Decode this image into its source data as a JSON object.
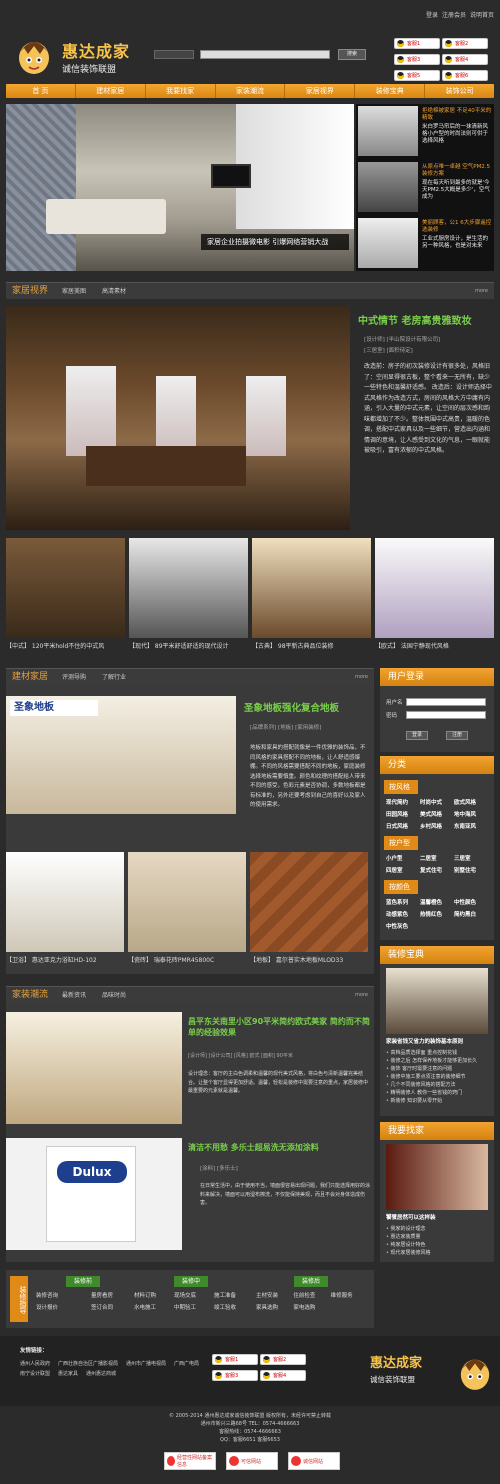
{
  "top_links": [
    "登录",
    "注册会员",
    "说明首页"
  ],
  "logo": {
    "title": "惠达成家",
    "subtitle": "诚信装饰联盟"
  },
  "search": {
    "select": "",
    "button": "搜索"
  },
  "qq": [
    "客服1",
    "客服2",
    "客服3",
    "客服4",
    "客服5",
    "客服6"
  ],
  "nav": [
    "首 页",
    "建材家居",
    "我要找家",
    "家装潮流",
    "家居视界",
    "装修宝典",
    "装饰公司"
  ],
  "hero": {
    "caption": "家居企业拍摄微电影 引爆网络营销大战"
  },
  "hero_side": [
    {
      "title": "拒绝棉被家居\n不足40平米的精致",
      "text": ""
    },
    {
      "title": "改造前：",
      "text": "米白罗马帘后的一抹清新风格小户型的时尚法则可供于选择风格"
    },
    {
      "title": "从原点唯一卓越\n空气PM2.5装修方案",
      "text": "现在每天听到最多的就是'今天PM2.5大概是多少'，空气成为"
    },
    {
      "title": "美丽顾客，公1\n6大步骤遥控选装修",
      "text": "工业式厨房设计，是生活的另一种风格，也是对未来"
    }
  ],
  "sec1": {
    "title": "家居视界",
    "subs": [
      "家居美图",
      "高清素材"
    ],
    "more": "more"
  },
  "article1": {
    "title": "中式情节 老房高贵雅致妆",
    "meta": "[设计师] [半山院设计有限公司]\n[三居室] [面积待定]",
    "text": "改造前：房子的初次装修设计有很多处，风格旧了：空间显得很古板，整个看来一无所有，缺少一些特色和温馨舒适感。 改造后：设计师选择中式风格作为改造方式，房间的风格大方中庸有内涵，引入大量的中式元素，让空间的层次感和韵味都增加了不少。整体氛围中式高贵，温暖的色调，搭配中式家具以及一些细节，营造出内涵和情调的意境，让人感受到文化的气息，一眼就能被吸引，富有浓郁的中式风格。"
  },
  "thumbs1": [
    "【中式】 120平米hold不住的中式风",
    "【现代】 89平米舒适舒适的现代设计",
    "【古典】 98平新古典品位装修",
    "【欧式】 法国宁静现代风格"
  ],
  "sec2": {
    "title": "建材家居",
    "subs": [
      "评测导购",
      "了解行业"
    ],
    "more": "more"
  },
  "article2": {
    "brand": "圣象地板",
    "title": "圣象地板强化复合地板",
    "meta": "[品牌系列] [地板] [家用装修]",
    "text": "地板和家具的搭配就像是一件优雅的装饰品，不同风格的家具搭配不同的地板，让人舒适感爆棚。不同的风格需要搭配不同的地板，家庭装修选择地板需要慎重。颜色和纹理的搭配给人带来不同的感受，色彩元素是否协调，多数地板都是有标准的，另外还要考虑到自己的喜好以及家人的使用需求。"
  },
  "thumbs2": [
    "【卫浴】 惠达亚克力浴缸HD-102",
    "【瓷砖】 瑞泰花砖PMR45800C",
    "【地板】 嘉尔普实木地板MLOD33"
  ],
  "sec3": {
    "title": "家装潮流",
    "subs": [
      "最新资讯",
      "品味时尚"
    ],
    "more": "more"
  },
  "article3": {
    "title": "昌平东关南里小区90平米简约欧式美家 简约而不简单的经验效果",
    "meta": "[设计师]  [设计公司]  [风格] 欧式  [面积] 90平米",
    "text": "设计理念：客厅的主白色调柔和温馨的现代美式风格，将白色与清新温馨完美结合。让整个客厅显得更加舒适。温馨，轻松是装修中需要注意的重点，家居装修中最重要的元素就是温馨。"
  },
  "article4": {
    "title": "清洁不用愁 多乐士超易洗无添加涂料",
    "meta": "[涂料] [多乐士]",
    "text": "在日常生活中，由于使用不当，墙面很容易出现问题，我们只能选择用好的涂料来解决，墙面可以用湿布擦洗，不仅能保持美观，而且不会对身体造成伤害。",
    "brand": "Dulux"
  },
  "login": {
    "title": "用户登录",
    "user_label": "用户名",
    "pass_label": "密码",
    "login_btn": "登录",
    "reg_btn": "注册"
  },
  "category": {
    "title": "分类",
    "groups": [
      {
        "name": "按风格",
        "items": [
          "现代简约",
          "时尚中式",
          "欧式风格",
          "田园风格",
          "美式风格",
          "地中海风",
          "日式风格",
          "乡村风格",
          "东南亚风"
        ]
      },
      {
        "name": "按户型",
        "items": [
          "小户型",
          "二居室",
          "三居室",
          "四居室",
          "复式住宅",
          "别墅住宅"
        ]
      },
      {
        "name": "按颜色",
        "items": [
          "蓝色系列",
          "温馨橙色",
          "中性颜色",
          "动感紫色",
          "热情红色",
          "简约黑白",
          "中性灰色"
        ]
      }
    ]
  },
  "baodian": {
    "title": "装修宝典",
    "headline": "家装省钱又省力的装饰基本原则",
    "items": [
      "高档品质选择面 重点控制花钱",
      "装修之后 怎样保养地板才能够更加长久",
      "装饰 客厅时需要注意的问题",
      "装修中施工要点须注意的装修细节",
      "几个不同装修风格的搭配方法",
      "精明装修人 教你一些省钱的窍门",
      "新装修 知识要从零开始"
    ]
  },
  "zhaojia": {
    "title": "我要找家",
    "headline": "饕餮居然可以这样装",
    "items": [
      "我家的设计理念",
      "惠达家装质量",
      "纯家居设计特色",
      "现代家居装修风格",
      "现代简约新颖",
      "装修选材"
    ]
  },
  "services": {
    "label": "装修指导",
    "cols": [
      {
        "head": "装修前",
        "items": [
          "装修咨询",
          "量房看房",
          "设计报价",
          "签订合同"
        ]
      },
      {
        "head": "装修中",
        "items": [
          "材料订购",
          "现场交底",
          "施工准备",
          "水电施工",
          "中期验工",
          "竣工验收"
        ]
      },
      {
        "head": "装修后",
        "items": [
          "主材安装",
          "住前检查",
          "维修服务",
          "家具选购",
          "家电选购",
          ""
        ]
      }
    ]
  },
  "friend_links": {
    "title": "友情链接：",
    "items": [
      "通州人民政府",
      "广西壮族自治区广播影视局",
      "通州市广播电视局",
      "广西广电局",
      "南宁设计联盟",
      "惠达家具",
      "通州惠达商城"
    ]
  },
  "footer": {
    "lines": [
      "© 2005-2014 通州惠达成家诚信装饰联盟 版权所有，未经许可禁止转载",
      "通州市新兴三路68号  TEL：0574-4666663",
      "客服热线：0574-4666663",
      "QQ：客服6651 客服6653"
    ],
    "badges": [
      "经营性网站备案信息",
      "可信网站",
      "诚信网站"
    ]
  },
  "colors": {
    "accent": "#f0a030",
    "green": "#7ad04a",
    "panel": "#3a3a3a"
  }
}
